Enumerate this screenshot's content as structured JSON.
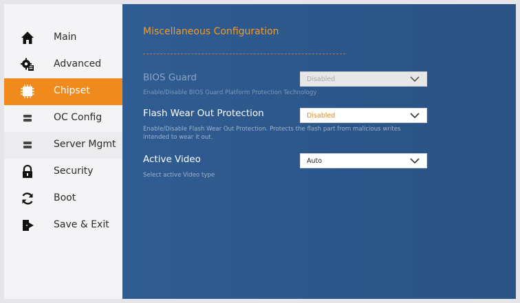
{
  "sidebar": {
    "items": [
      {
        "label": "Main",
        "icon": "home-icon"
      },
      {
        "label": "Advanced",
        "icon": "advanced-gear-icon"
      },
      {
        "label": "Chipset",
        "icon": "chip-icon",
        "active": true
      },
      {
        "label": "OC Config",
        "icon": "memory-stick-icon"
      },
      {
        "label": "Server Mgmt",
        "icon": "server-icon"
      },
      {
        "label": "Security",
        "icon": "lock-icon"
      },
      {
        "label": "Boot",
        "icon": "refresh-icon"
      },
      {
        "label": "Save & Exit",
        "icon": "exit-door-icon"
      }
    ]
  },
  "main": {
    "heading": "Miscellaneous Configuration",
    "settings": [
      {
        "title": "BIOS Guard",
        "description": "Enable/Disable BIOS Guard Platform Protection Technology",
        "value": "Disabled",
        "disabled": true
      },
      {
        "title": "Flash Wear Out Protection",
        "description": "Enable/Disable Flash Wear Out Protection.  Protects the flash part from malicious writes intended to wear it out.",
        "value": "Disabled",
        "disabled": false
      },
      {
        "title": "Active Video",
        "description": "Select active Video type",
        "value": "Auto",
        "disabled": false
      }
    ]
  },
  "colors": {
    "accent": "#f08a1c",
    "panel_blue": "#2e5a8e",
    "value_orange": "#e8891e"
  }
}
